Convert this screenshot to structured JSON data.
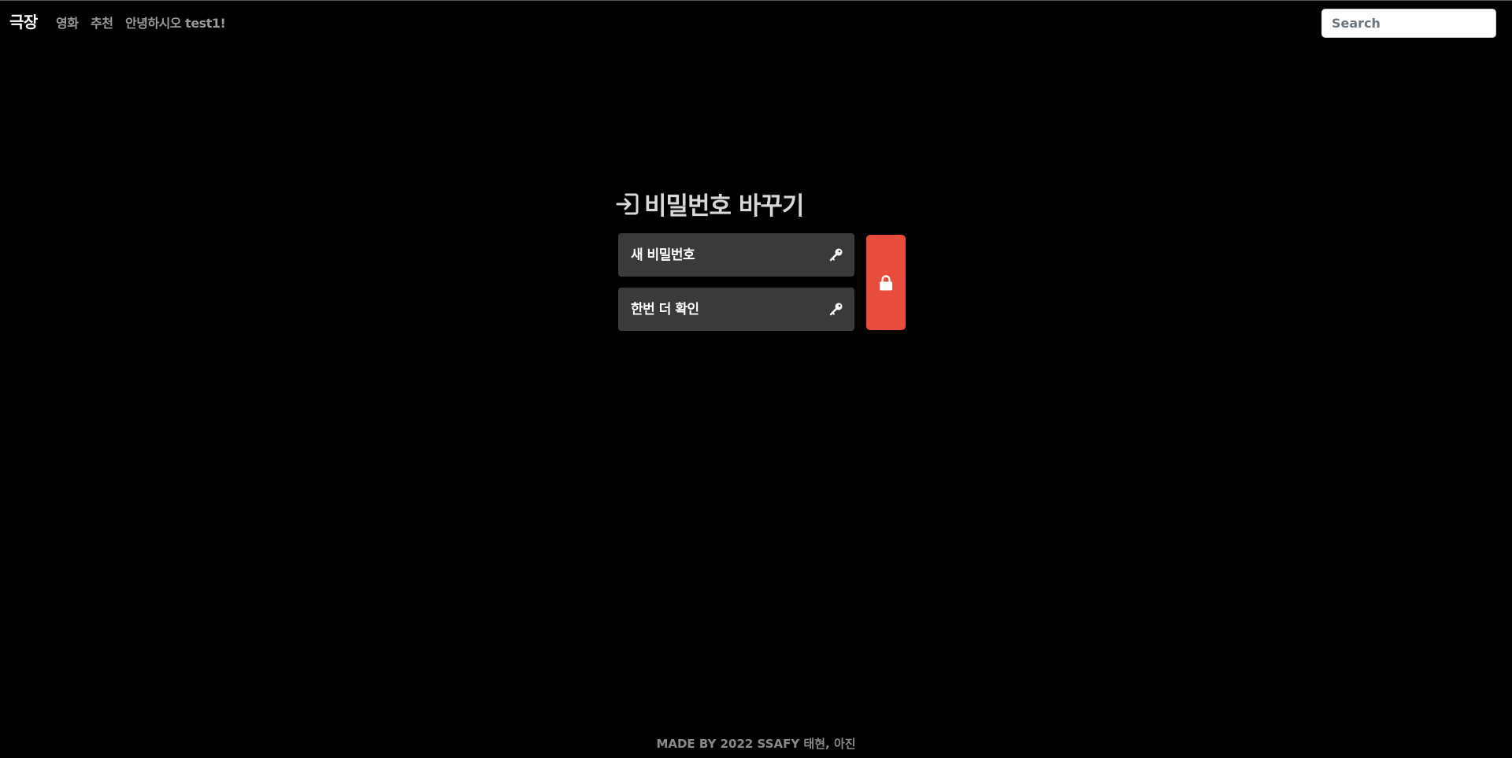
{
  "navbar": {
    "brand": "극장",
    "links": [
      {
        "label": "영화"
      },
      {
        "label": "추천"
      }
    ],
    "greeting": "안녕하시오 test1!",
    "search": {
      "placeholder": "Search",
      "value": ""
    }
  },
  "main": {
    "title": "비밀번호 바꾸기",
    "title_icon": "login-icon",
    "fields": [
      {
        "placeholder": "새 비밀번호",
        "value": "",
        "icon": "key-icon"
      },
      {
        "placeholder": "한번 더 확인",
        "value": "",
        "icon": "key-icon"
      }
    ],
    "submit": {
      "icon": "lock-icon",
      "color": "#e74c3c"
    }
  },
  "footer": {
    "text": "MADE BY 2022 SSAFY 태현, 아진"
  },
  "colors": {
    "background": "#000000",
    "field_background": "#3a3a3a",
    "accent": "#e74c3c"
  }
}
